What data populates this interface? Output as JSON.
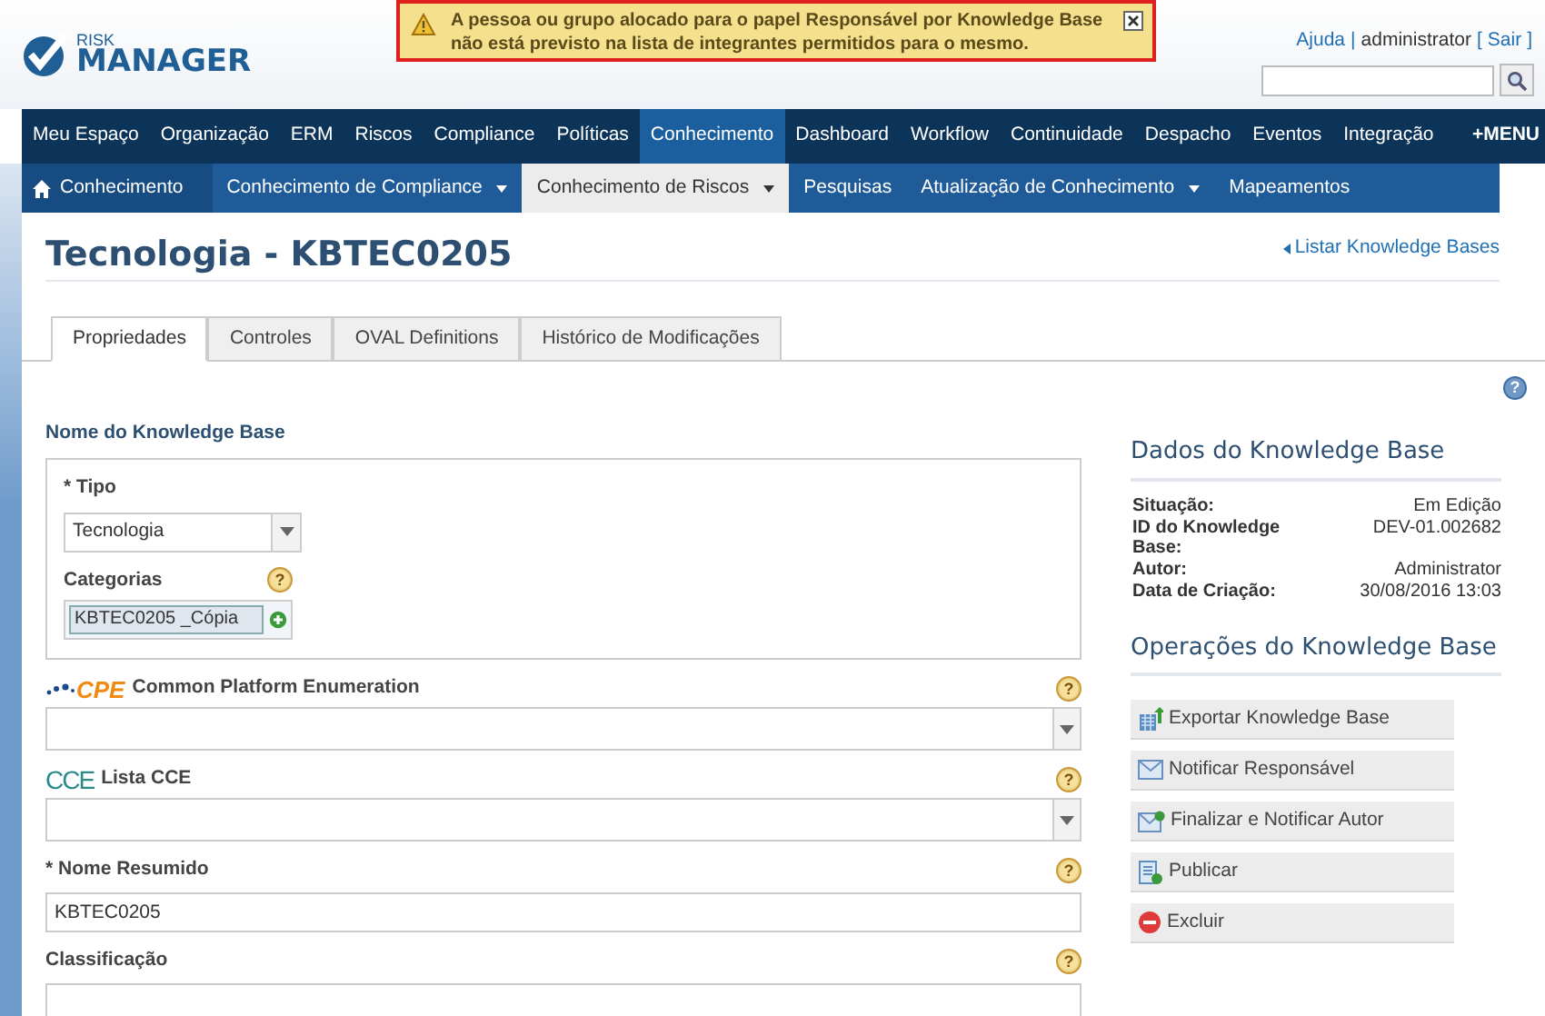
{
  "alert": {
    "message": "A pessoa ou grupo alocado para o papel Responsável por Knowledge Base não está previsto na lista de integrantes permitidos para o mesmo."
  },
  "logo": {
    "line_1": "RISK",
    "line_2": "MANAGER"
  },
  "user_links": [
    {
      "label": "Ajuda",
      "kind": "link"
    },
    {
      "label": "|",
      "kind": "sep"
    },
    {
      "label": "administrator",
      "kind": "text"
    },
    {
      "label": "[",
      "kind": "sep"
    },
    {
      "label": "Sair",
      "kind": "link"
    },
    {
      "label": "]",
      "kind": "sep"
    }
  ],
  "nav": {
    "items": [
      {
        "label": "Meu Espaço",
        "selected": false
      },
      {
        "label": "Organização",
        "selected": false
      },
      {
        "label": "ERM",
        "selected": false
      },
      {
        "label": "Riscos",
        "selected": false
      },
      {
        "label": "Compliance",
        "selected": false
      },
      {
        "label": "Políticas",
        "selected": false
      },
      {
        "label": "Conhecimento",
        "selected": true
      },
      {
        "label": "Dashboard",
        "selected": false
      },
      {
        "label": "Workflow",
        "selected": false
      },
      {
        "label": "Continuidade",
        "selected": false
      },
      {
        "label": "Despacho",
        "selected": false
      },
      {
        "label": "Eventos",
        "selected": false
      },
      {
        "label": "Integração",
        "selected": false
      }
    ],
    "menu_button": "+MENU"
  },
  "subnav": {
    "home": "Conhecimento",
    "items": [
      {
        "label": "Conhecimento de Compliance",
        "selected": false,
        "dropdown": true
      },
      {
        "label": "Conhecimento de Riscos",
        "selected": true,
        "dropdown": true
      },
      {
        "label": "Pesquisas",
        "selected": false,
        "dropdown": false
      },
      {
        "label": "Atualização de Conhecimento",
        "selected": false,
        "dropdown": true
      },
      {
        "label": "Mapeamentos",
        "selected": false,
        "dropdown": false
      }
    ]
  },
  "page": {
    "title": "Tecnologia - KBTEC0205",
    "back_link": "Listar Knowledge Bases",
    "help": "?"
  },
  "tabs": [
    {
      "label": "Propriedades",
      "selected": true
    },
    {
      "label": "Controles",
      "selected": false
    },
    {
      "label": "OVAL Definitions",
      "selected": false
    },
    {
      "label": "Histórico de Modificações",
      "selected": false
    }
  ],
  "form": {
    "section": "Nome do Knowledge Base",
    "tipo": {
      "label": "* Tipo",
      "value": "Tecnologia"
    },
    "categorias": {
      "label": "Categorias",
      "chip": "KBTEC0205 _Cópia",
      "help": "?"
    },
    "fields": [
      {
        "kind": "select",
        "logo": {
          "kind": "cpe",
          "text": "CPE"
        },
        "label": "Common Platform Enumeration",
        "help": "?"
      },
      {
        "kind": "select",
        "logo": {
          "kind": "cce",
          "text": "CCE"
        },
        "label": "Lista CCE",
        "help": "?"
      },
      {
        "kind": "text",
        "label": "* Nome Resumido",
        "value": "KBTEC0205",
        "help": "?"
      },
      {
        "kind": "text",
        "label": "Classificação",
        "help": "?"
      }
    ]
  },
  "details": {
    "title": "Dados do Knowledge Base",
    "rows": [
      {
        "label": "Situação:",
        "value": "Em Edição"
      },
      {
        "label": "ID do Knowledge Base:",
        "value": "DEV-01.002682"
      },
      {
        "label": "Autor:",
        "value": "Administrator"
      },
      {
        "label": "Data de Criação:",
        "value": "30/08/2016 13:03"
      }
    ]
  },
  "operations": {
    "title": "Operações do Knowledge Base",
    "buttons": [
      {
        "label": "Exportar Knowledge Base",
        "kind": "export"
      },
      {
        "label": "Notificar Responsável",
        "kind": "notify"
      },
      {
        "label": "Finalizar e Notificar Autor",
        "kind": "finish"
      },
      {
        "label": "Publicar",
        "kind": "publish"
      },
      {
        "label": "Excluir",
        "kind": "delete"
      }
    ]
  }
}
